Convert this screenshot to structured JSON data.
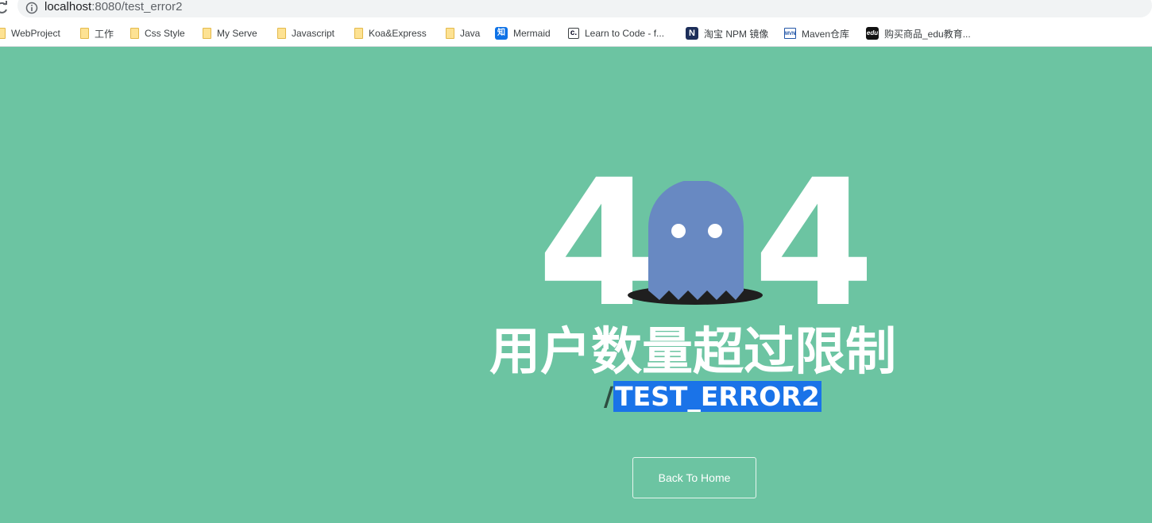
{
  "browser": {
    "url_host": "localhost",
    "url_rest": ":8080/test_error2",
    "bookmarks": [
      {
        "label": "WebProject",
        "icon": "folder-icon"
      },
      {
        "label": "工作",
        "icon": "folder-icon"
      },
      {
        "label": "Css Style",
        "icon": "folder-icon"
      },
      {
        "label": "My Serve",
        "icon": "folder-icon"
      },
      {
        "label": "Javascript",
        "icon": "folder-icon"
      },
      {
        "label": "Koa&Express",
        "icon": "folder-icon"
      },
      {
        "label": "Java",
        "icon": "folder-icon"
      },
      {
        "label": "Mermaid",
        "icon": "zhihu-icon",
        "glyph": "知"
      },
      {
        "label": "Learn to Code - f...",
        "icon": "freecodecamp-icon",
        "glyph": "c."
      },
      {
        "label": "淘宝 NPM 镜像",
        "icon": "npm-mirror-icon",
        "glyph": "N"
      },
      {
        "label": "Maven仓库",
        "icon": "maven-icon",
        "glyph": "MVN"
      },
      {
        "label": "购买商品_edu教育...",
        "icon": "edu-icon",
        "glyph": "edu"
      }
    ]
  },
  "page": {
    "digit_left": "4",
    "digit_right": "4",
    "title": "用户数量超过限制",
    "path_slash": "/",
    "path_name": "TEST_ERROR2",
    "home_button": "Back To Home"
  },
  "colors": {
    "background": "#6cc4a2",
    "ghost": "#6889c2",
    "hole": "#1f1f1f",
    "selection": "#1a73e8"
  }
}
